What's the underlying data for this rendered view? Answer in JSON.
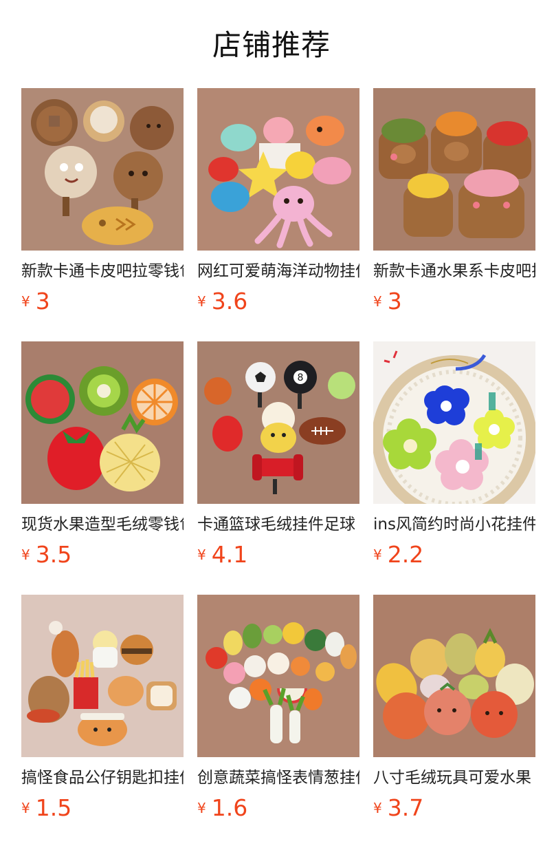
{
  "page": {
    "title": "店铺推荐"
  },
  "colors": {
    "price": "#f0441b",
    "title": "#111111",
    "text": "#222222"
  },
  "products": [
    {
      "name": "新款卡通卡皮吧拉零钱包",
      "currency": "¥",
      "price": "3",
      "image": "capybara-plush-coin-purses",
      "bg": "#b08a76"
    },
    {
      "name": "网红可爱萌海洋动物挂件",
      "currency": "¥",
      "price": "3.6",
      "image": "ocean-animal-plush-keychains",
      "bg": "#b48873"
    },
    {
      "name": "新款卡通水果系卡皮吧拉",
      "currency": "¥",
      "price": "3",
      "image": "fruit-capybara-pouches",
      "bg": "#a97f6a"
    },
    {
      "name": "现货水果造型毛绒零钱包",
      "currency": "¥",
      "price": "3.5",
      "image": "fruit-plush-coin-purses",
      "bg": "#a97e6c"
    },
    {
      "name": "卡通篮球毛绒挂件足球",
      "currency": "¥",
      "price": "4.1",
      "image": "sports-ball-plush-pendants",
      "bg": "#a8816e"
    },
    {
      "name": "ins风简约时尚小花挂件",
      "currency": "¥",
      "price": "2.2",
      "image": "flower-plush-keychains",
      "bg": "#f4f1ee"
    },
    {
      "name": "搞怪食品公仔钥匙扣挂件",
      "currency": "¥",
      "price": "1.5",
      "image": "food-doll-keychains",
      "bg": "#dcc6bc"
    },
    {
      "name": "创意蔬菜搞怪表情葱挂件",
      "currency": "¥",
      "price": "1.6",
      "image": "vegetable-face-plush",
      "bg": "#b28671"
    },
    {
      "name": "八寸毛绒玩具可爱水果",
      "currency": "¥",
      "price": "3.7",
      "image": "eight-inch-fruit-plush",
      "bg": "#ad7f69"
    }
  ]
}
